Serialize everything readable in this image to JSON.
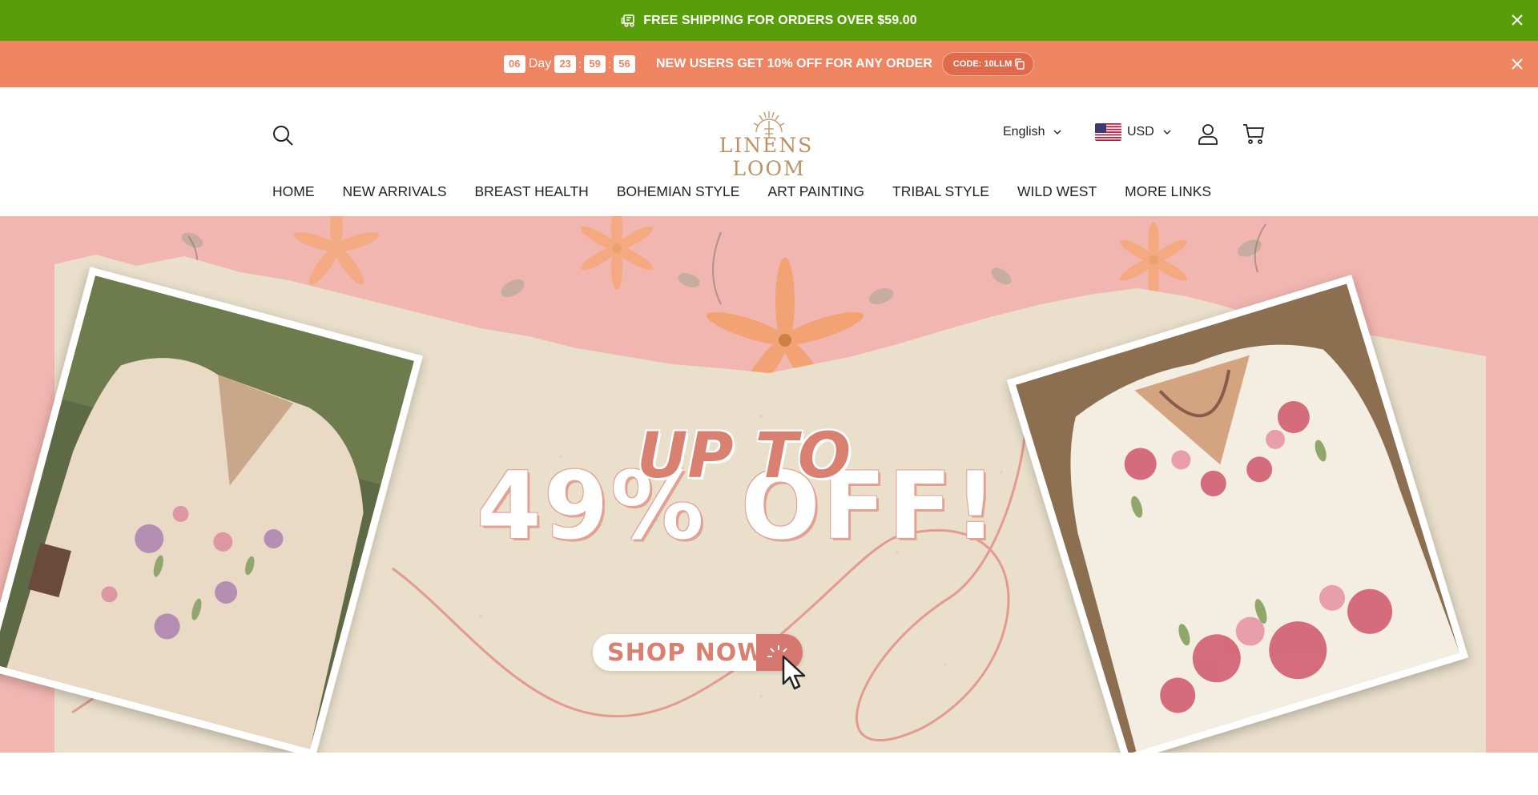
{
  "shipping_bar": {
    "text": "FREE SHIPPING FOR ORDERS OVER $59.00",
    "icon": "truck-icon",
    "background": "#589d0a"
  },
  "promo_bar": {
    "countdown": {
      "days": "06",
      "day_label": "Day",
      "hours": "23",
      "minutes": "59",
      "seconds": "56"
    },
    "text": "NEW USERS GET 10% OFF FOR ANY ORDER",
    "code_label": "CODE: 10LLM",
    "background": "#ee8462"
  },
  "header": {
    "logo_text": "LINENS LOOM",
    "language": "English",
    "currency": "USD"
  },
  "nav": {
    "items": [
      {
        "label": "HOME"
      },
      {
        "label": "NEW ARRIVALS"
      },
      {
        "label": "BREAST HEALTH"
      },
      {
        "label": "BOHEMIAN STYLE"
      },
      {
        "label": "ART PAINTING"
      },
      {
        "label": "TRIBAL STYLE"
      },
      {
        "label": "WILD WEST"
      },
      {
        "label": "MORE LINKS"
      }
    ]
  },
  "hero": {
    "up_to": "UP TO",
    "discount": "49% OFF!",
    "cta": "SHOP NOW",
    "accent": "#d98070"
  }
}
